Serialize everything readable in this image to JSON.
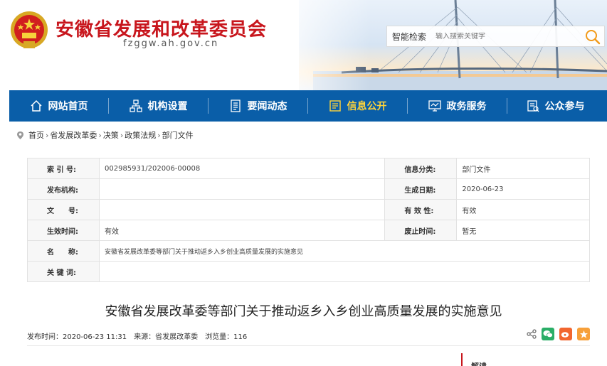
{
  "header": {
    "site_title": "安徽省发展和改革委员会",
    "site_url": "fzggw.ah.gov.cn",
    "search_label": "智能检索",
    "search_placeholder": "输入搜索关键字"
  },
  "nav": {
    "items": [
      {
        "label": "网站首页",
        "icon": "home-icon"
      },
      {
        "label": "机构设置",
        "icon": "org-chart-icon"
      },
      {
        "label": "要闻动态",
        "icon": "news-icon"
      },
      {
        "label": "信息公开",
        "icon": "info-board-icon",
        "active": true
      },
      {
        "label": "政务服务",
        "icon": "monitor-icon"
      },
      {
        "label": "公众参与",
        "icon": "participation-icon"
      }
    ]
  },
  "breadcrumb": [
    "首页",
    "省发展改革委",
    "决策",
    "政策法规",
    "部门文件"
  ],
  "info": {
    "index_label": "索 引 号:",
    "index_value": "002985931/202006-00008",
    "category_label": "信息分类:",
    "category_value": "部门文件",
    "publisher_label": "发布机构:",
    "publisher_value": "",
    "created_label": "生成日期:",
    "created_value": "2020-06-23",
    "docno_label": "文　　号:",
    "docno_value": "",
    "validity_label": "有 效 性:",
    "validity_value": "有效",
    "effective_label": "生效时间:",
    "effective_value": "有效",
    "abolish_label": "废止时间:",
    "abolish_value": "暂无",
    "name_label": "名　　称:",
    "name_value": "安徽省发展改革委等部门关于推动返乡入乡创业高质量发展的实施意见",
    "keywords_label": "关 键 词:",
    "keywords_value": ""
  },
  "article": {
    "title": "安徽省发展改革委等部门关于推动返乡入乡创业高质量发展的实施意见",
    "publish_time": "发布时间：2020-06-23 11:31",
    "source": "来源：省发展改革委",
    "views": "浏览量：116"
  },
  "side": {
    "tab_label": "解读"
  },
  "colors": {
    "brand_red": "#c8161d",
    "nav_blue": "#0a5ea8",
    "nav_active": "#ffd43a",
    "wechat_green": "#2aae67",
    "weibo_orange": "#f2662f",
    "star_orange": "#f7a03a"
  }
}
